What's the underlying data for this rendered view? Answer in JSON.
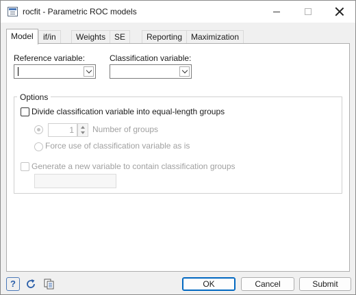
{
  "window": {
    "title": "rocfit - Parametric ROC models"
  },
  "tabs": [
    {
      "label": "Model",
      "active": true
    },
    {
      "label": "if/in",
      "active": false
    },
    {
      "label": "Weights",
      "active": false
    },
    {
      "label": "SE",
      "active": false
    },
    {
      "label": "Reporting",
      "active": false
    },
    {
      "label": "Maximization",
      "active": false
    }
  ],
  "model": {
    "reference_variable": {
      "label": "Reference variable:",
      "value": ""
    },
    "classification_variable": {
      "label": "Classification variable:",
      "value": ""
    }
  },
  "options": {
    "title": "Options",
    "divide_checkbox": {
      "label": "Divide classification variable into equal-length groups",
      "checked": false
    },
    "number_of_groups": {
      "value": "1",
      "label": "Number of groups",
      "enabled": false
    },
    "force_use": {
      "label": "Force use of classification variable as is",
      "enabled": false
    },
    "generate_checkbox": {
      "label": "Generate a new variable to contain classification groups",
      "checked": false,
      "enabled": false
    },
    "generate_value": ""
  },
  "footer": {
    "help_label": "?",
    "ok_label": "OK",
    "cancel_label": "Cancel",
    "submit_label": "Submit"
  },
  "icons": [
    "dialog-app-icon",
    "minimize-icon",
    "maximize-icon",
    "close-icon",
    "help-icon",
    "reset-icon",
    "copy-icon",
    "chevron-down-icon"
  ],
  "colors": {
    "accent": "#0067c0",
    "window_bg": "#f0f0f0",
    "panel_bg": "#ffffff",
    "disabled_text": "#a0a0a0"
  }
}
